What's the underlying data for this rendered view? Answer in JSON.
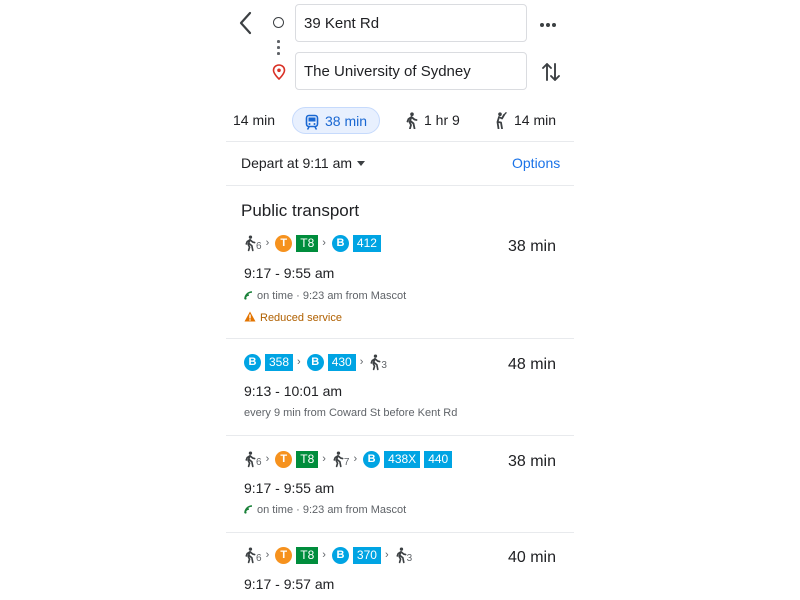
{
  "header": {
    "origin_value": "39 Kent Rd",
    "destination_value": "The University of Sydney",
    "back_icon": "chevron-left-icon",
    "more_icon": "more-horizontal-icon",
    "swap_icon": "swap-vertical-icon"
  },
  "modes": [
    {
      "icon": "car-icon",
      "label": "14 min",
      "active": false
    },
    {
      "icon": "transit-icon",
      "label": "38 min",
      "active": true
    },
    {
      "icon": "walk-icon",
      "label": "1 hr 9",
      "active": false
    },
    {
      "icon": "ride-icon",
      "label": "14 min",
      "active": false
    }
  ],
  "depart": {
    "label": "Depart at 9:11 am"
  },
  "options_label": "Options",
  "section_title": "Public transport",
  "routes": [
    {
      "duration": "38 min",
      "time": "9:17 - 9:55 am",
      "info": "on time · 9:23 am from Mascot",
      "warning": "Reduced service",
      "walk1": "6",
      "lines": [
        "T8",
        "412"
      ]
    },
    {
      "duration": "48 min",
      "time": "9:13 - 10:01 am",
      "info": "every 9 min from Coward St before Kent Rd",
      "walk1": "3",
      "lines": [
        "358",
        "430"
      ]
    },
    {
      "duration": "38 min",
      "time": "9:17 - 9:55 am",
      "info": "on time · 9:23 am from Mascot",
      "walk1": "6",
      "walk2": "7",
      "lines": [
        "T8",
        "438X",
        "440"
      ]
    },
    {
      "duration": "40 min",
      "time": "9:17 - 9:57 am",
      "walk1": "6",
      "walk2": "3",
      "lines": [
        "T8",
        "370"
      ]
    }
  ],
  "badges": {
    "train_letter": "T",
    "bus_letter": "B"
  },
  "colors": {
    "accent": "#1a73e8",
    "train": "#f6921e",
    "t8": "#008d3c",
    "bus": "#00a4e3",
    "warning": "#b06000",
    "realtime": "#188038"
  }
}
